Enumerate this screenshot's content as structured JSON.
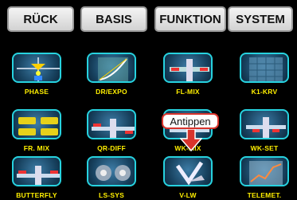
{
  "tabs": {
    "back": "RÜCK",
    "basis": "BASIS",
    "funktion": "FUNKTION",
    "system": "SYSTEM"
  },
  "menu": [
    "PHASE",
    "DR/EXPO",
    "FL-MIX",
    "K1-KRV",
    "FR. MIX",
    "QR-DIFF",
    "WK-MIX",
    "WK-SET",
    "BUTTERFLY",
    "LS-SYS",
    "V-LW",
    "TELEMET."
  ],
  "callout": "Antippen",
  "colors": {
    "tile_border": "#27d2df",
    "label": "#ffef00",
    "callout_border": "#d8342c"
  }
}
